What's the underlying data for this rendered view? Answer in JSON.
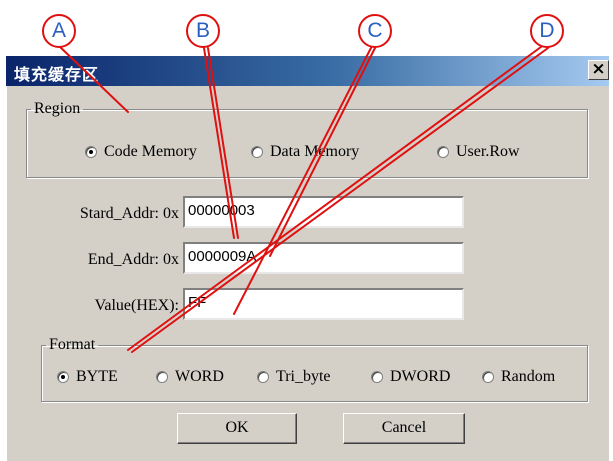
{
  "window": {
    "title": "填充缓存区",
    "close_glyph": "×"
  },
  "callouts": [
    "A",
    "B",
    "C",
    "D"
  ],
  "region": {
    "legend": "Region",
    "options": [
      {
        "label": "Code Memory",
        "checked": true
      },
      {
        "label": "Data Memory",
        "checked": false
      },
      {
        "label": "User.Row",
        "checked": false
      }
    ]
  },
  "fields": [
    {
      "label": "Stard_Addr: 0x",
      "value": "00000003"
    },
    {
      "label": "End_Addr: 0x",
      "value": "0000009A"
    },
    {
      "label": "Value(HEX):",
      "value": "FF"
    }
  ],
  "format": {
    "legend": "Format",
    "options": [
      {
        "label": "BYTE",
        "checked": true
      },
      {
        "label": "WORD",
        "checked": false
      },
      {
        "label": "Tri_byte",
        "checked": false
      },
      {
        "label": "DWORD",
        "checked": false
      },
      {
        "label": "Random",
        "checked": false
      }
    ]
  },
  "buttons": {
    "ok": "OK",
    "cancel": "Cancel"
  },
  "colors": {
    "callout_border": "#e01010",
    "callout_text": "#2a5fbf",
    "leader_line": "#e01010",
    "titlebar": "#0a246a"
  },
  "icons": {
    "close": "close-icon",
    "radio": "radio-button-icon"
  }
}
